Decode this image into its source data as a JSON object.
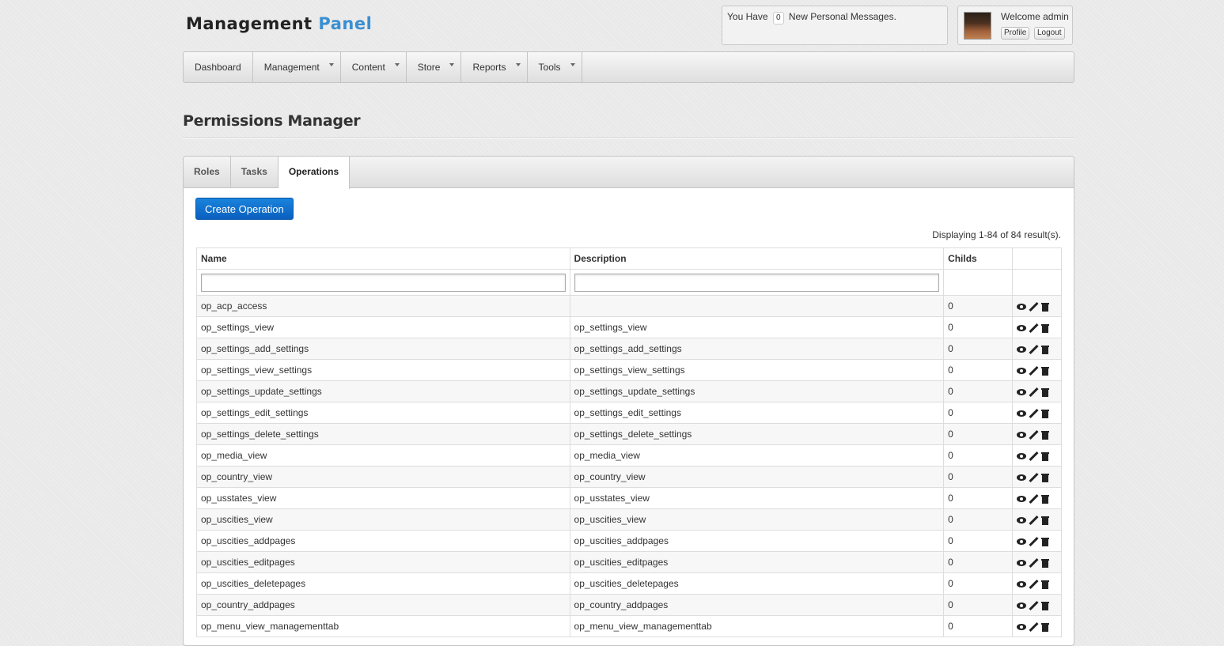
{
  "header": {
    "logo_part1": "Management",
    "logo_part2": "Panel",
    "messages_prefix": "You Have",
    "messages_count": "0",
    "messages_suffix": "New Personal Messages.",
    "welcome": "Welcome admin",
    "profile_label": "Profile",
    "logout_label": "Logout"
  },
  "nav": {
    "items": [
      {
        "label": "Dashboard"
      },
      {
        "label": "Management"
      },
      {
        "label": "Content"
      },
      {
        "label": "Store"
      },
      {
        "label": "Reports"
      },
      {
        "label": "Tools"
      }
    ]
  },
  "page": {
    "title": "Permissions Manager"
  },
  "tabs": [
    "Roles",
    "Tasks",
    "Operations"
  ],
  "active_tab": "Operations",
  "toolbar": {
    "create_label": "Create Operation"
  },
  "summary": "Displaying 1-84 of 84 result(s).",
  "table": {
    "columns": [
      "Name",
      "Description",
      "Childs",
      ""
    ],
    "rows": [
      {
        "name": "op_acp_access",
        "description": "",
        "childs": "0"
      },
      {
        "name": "op_settings_view",
        "description": "op_settings_view",
        "childs": "0"
      },
      {
        "name": "op_settings_add_settings",
        "description": "op_settings_add_settings",
        "childs": "0"
      },
      {
        "name": "op_settings_view_settings",
        "description": "op_settings_view_settings",
        "childs": "0"
      },
      {
        "name": "op_settings_update_settings",
        "description": "op_settings_update_settings",
        "childs": "0"
      },
      {
        "name": "op_settings_edit_settings",
        "description": "op_settings_edit_settings",
        "childs": "0"
      },
      {
        "name": "op_settings_delete_settings",
        "description": "op_settings_delete_settings",
        "childs": "0"
      },
      {
        "name": "op_media_view",
        "description": "op_media_view",
        "childs": "0"
      },
      {
        "name": "op_country_view",
        "description": "op_country_view",
        "childs": "0"
      },
      {
        "name": "op_usstates_view",
        "description": "op_usstates_view",
        "childs": "0"
      },
      {
        "name": "op_uscities_view",
        "description": "op_uscities_view",
        "childs": "0"
      },
      {
        "name": "op_uscities_addpages",
        "description": "op_uscities_addpages",
        "childs": "0"
      },
      {
        "name": "op_uscities_editpages",
        "description": "op_uscities_editpages",
        "childs": "0"
      },
      {
        "name": "op_uscities_deletepages",
        "description": "op_uscities_deletepages",
        "childs": "0"
      },
      {
        "name": "op_country_addpages",
        "description": "op_country_addpages",
        "childs": "0"
      },
      {
        "name": "op_menu_view_managementtab",
        "description": "op_menu_view_managementtab",
        "childs": "0"
      }
    ]
  },
  "row_actions": [
    "view-icon",
    "edit-icon",
    "delete-icon"
  ],
  "colors": {
    "accent": "#3a8fd0",
    "button": "#0a6fd0"
  }
}
